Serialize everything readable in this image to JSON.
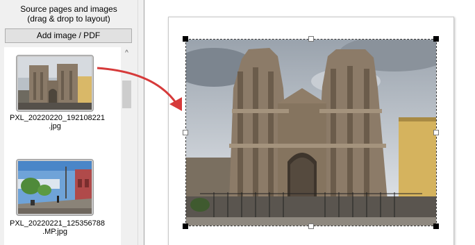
{
  "source_panel": {
    "heading_line1": "Source pages and images",
    "heading_line2": "(drag & drop to layout)",
    "add_button_label": "Add image / PDF",
    "scroll_up_glyph": "^",
    "thumbnails": [
      {
        "name_line1": "PXL_20220220_192108221",
        "name_line2": ".jpg"
      },
      {
        "name_line1": "PXL_20220221_125356788",
        "name_line2": ".MP.jpg"
      }
    ]
  },
  "colors": {
    "arrow": "#d63a3a",
    "selection_handles": "#000000",
    "page_background": "#ffffff",
    "panel_background": "#f0f0f0"
  },
  "icons": {
    "drag_hint": "curved-arrow-icon",
    "scroll_up": "chevron-up-icon"
  }
}
